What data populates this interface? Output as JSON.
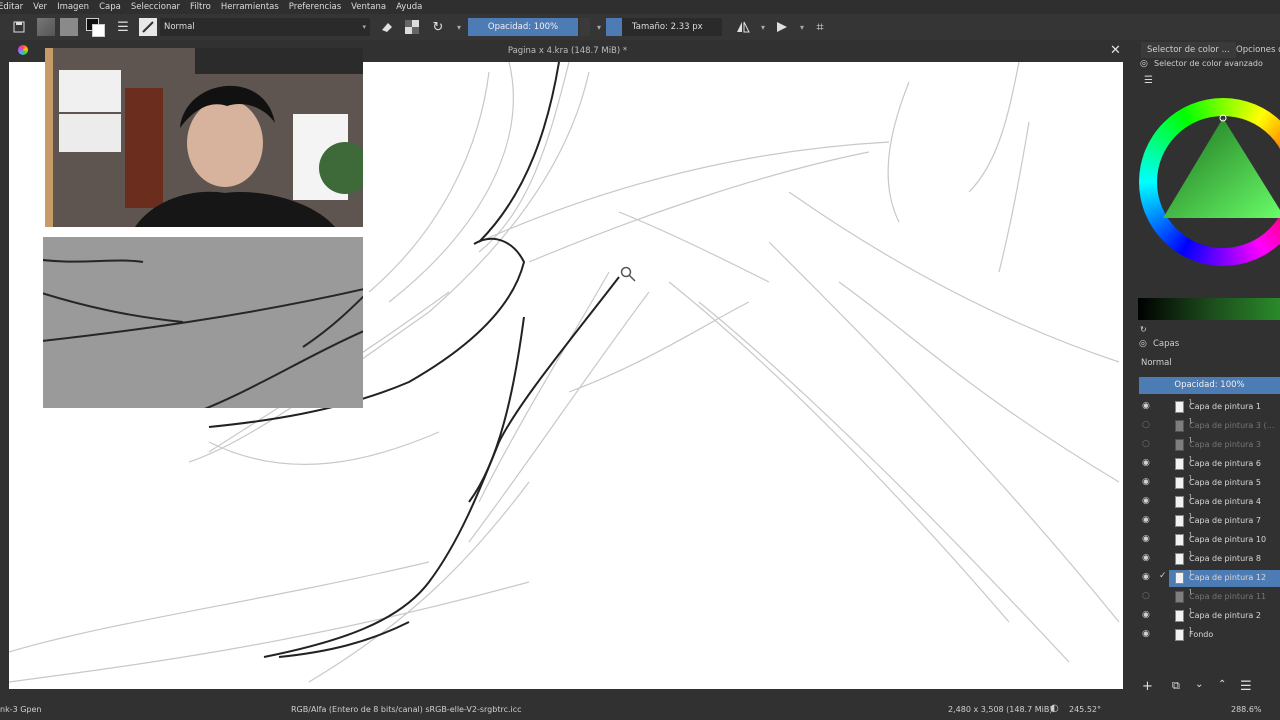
{
  "menu": [
    "Editar",
    "Ver",
    "Imagen",
    "Capa",
    "Seleccionar",
    "Filtro",
    "Herramientas",
    "Preferencias",
    "Ventana",
    "Ayuda"
  ],
  "toolbar": {
    "blend_mode": "Normal",
    "opacity_label": "Opacidad: 100%",
    "size_label": "Tamaño: 2.33 px"
  },
  "document": {
    "title": "Pagina x 4.kra (148.7 MiB) *",
    "close_glyph": "✕"
  },
  "dock": {
    "tabs": [
      "Selector de color ...",
      "Opciones de"
    ],
    "color_panel_title": "Selector de color avanzado",
    "layers_title": "Capas",
    "layers_blend": "Normal",
    "layers_opacity": "Opacidad:  100%",
    "layers": [
      {
        "name": "Capa de pintura 1",
        "visible": true,
        "selected": false,
        "dim": false
      },
      {
        "name": "Capa de pintura 3 (...",
        "visible": false,
        "selected": false,
        "dim": true
      },
      {
        "name": "Capa de pintura 3",
        "visible": false,
        "selected": false,
        "dim": true
      },
      {
        "name": "Capa de pintura 6",
        "visible": true,
        "selected": false,
        "dim": false
      },
      {
        "name": "Capa de pintura 5",
        "visible": true,
        "selected": false,
        "dim": false
      },
      {
        "name": "Capa de pintura 4",
        "visible": true,
        "selected": false,
        "dim": false
      },
      {
        "name": "Capa de pintura 7",
        "visible": true,
        "selected": false,
        "dim": false
      },
      {
        "name": "Capa de pintura 10",
        "visible": true,
        "selected": false,
        "dim": false
      },
      {
        "name": "Capa de pintura 8",
        "visible": true,
        "selected": false,
        "dim": false
      },
      {
        "name": "Capa de pintura 12",
        "visible": true,
        "selected": true,
        "dim": false
      },
      {
        "name": "Capa de pintura 11",
        "visible": false,
        "selected": false,
        "dim": true
      },
      {
        "name": "Capa de pintura 2",
        "visible": true,
        "selected": false,
        "dim": false
      },
      {
        "name": "Fondo",
        "visible": true,
        "selected": false,
        "dim": false
      }
    ]
  },
  "status": {
    "left": "nk-3 Gpen",
    "colorspace": "RGB/Alfa (Entero de 8 bits/canal)  sRGB-elle-V2-srgbtrc.icc",
    "dimensions": "2,480 x 3,508 (148.7 MiB)",
    "rotation": "245.52°",
    "zoom": "288.6%"
  },
  "colors": {
    "accent": "#4d7bb3",
    "background": "#313131",
    "canvas": "#ffffff"
  }
}
